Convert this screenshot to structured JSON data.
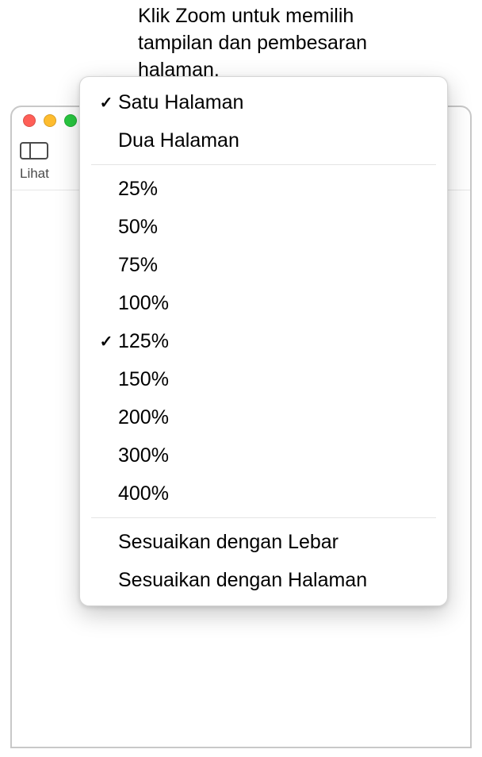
{
  "annotation": "Klik Zoom untuk memilih tampilan dan pembesaran halaman.",
  "toolbar": {
    "view_label": "Lihat",
    "zoom_value": "125%"
  },
  "menu": {
    "page_view": [
      {
        "label": "Satu Halaman",
        "checked": true
      },
      {
        "label": "Dua Halaman",
        "checked": false
      }
    ],
    "zoom_levels": [
      {
        "label": "25%",
        "checked": false
      },
      {
        "label": "50%",
        "checked": false
      },
      {
        "label": "75%",
        "checked": false
      },
      {
        "label": "100%",
        "checked": false
      },
      {
        "label": "125%",
        "checked": true
      },
      {
        "label": "150%",
        "checked": false
      },
      {
        "label": "200%",
        "checked": false
      },
      {
        "label": "300%",
        "checked": false
      },
      {
        "label": "400%",
        "checked": false
      }
    ],
    "fit_options": [
      {
        "label": "Sesuaikan dengan Lebar"
      },
      {
        "label": "Sesuaikan dengan Halaman"
      }
    ]
  }
}
